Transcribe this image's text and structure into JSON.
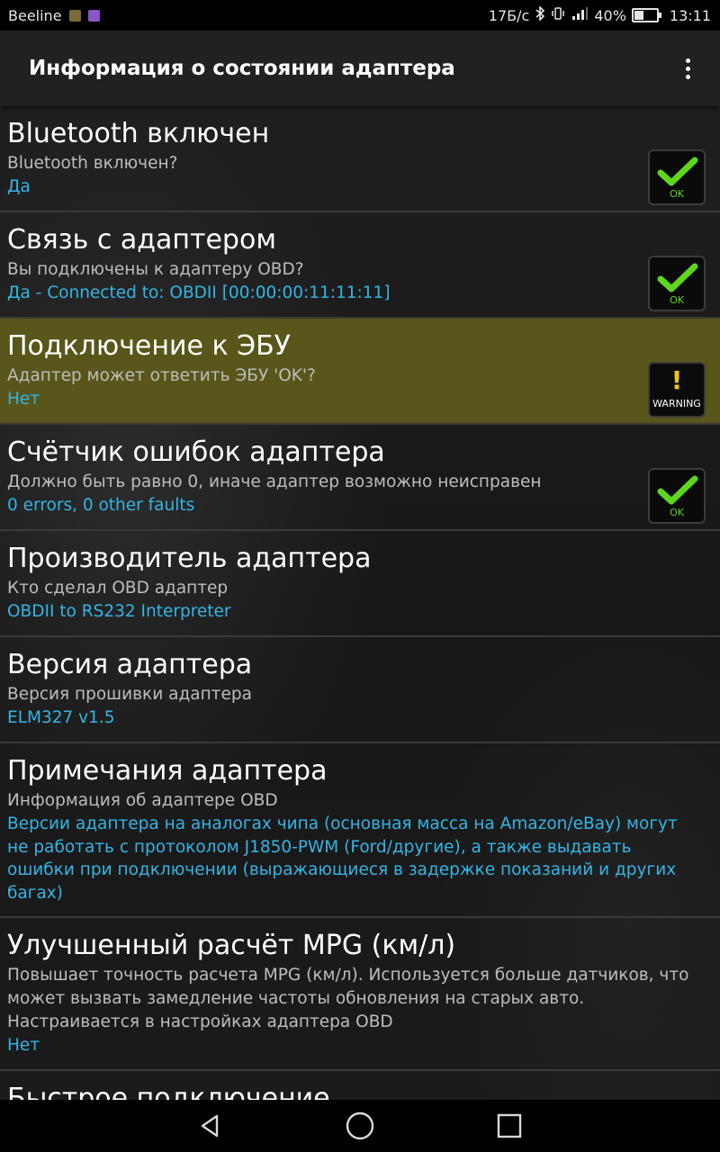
{
  "status_bar": {
    "carrier": "Beeline",
    "speed": "17Б/с",
    "battery": "40%",
    "battery_level": 0.4,
    "time": "13:11",
    "icons": [
      "gallery-icon",
      "viber-icon",
      "bluetooth-icon",
      "vibrate-icon",
      "signal-icon",
      "battery-icon"
    ]
  },
  "app_bar": {
    "title": "Информация о состоянии адаптера",
    "menu_icon": "overflow-menu-icon"
  },
  "colors": {
    "accent": "#33b5e5",
    "highlight": "#58561a",
    "ok_green": "#5ed61d",
    "warning_yellow": "#f0c419"
  },
  "items": [
    {
      "title": "Bluetooth включен",
      "subtitle": "Bluetooth включен?",
      "value": "Да",
      "status": "OK"
    },
    {
      "title": "Связь с адаптером",
      "subtitle": "Вы подключены к адаптеру OBD?",
      "value": "Да - Connected to: OBDII [00:00:00:11:11:11]",
      "status": "OK"
    },
    {
      "title": "Подключение к ЭБУ",
      "subtitle": "Адаптер может ответить ЭБУ 'OK'?",
      "value": "Нет",
      "status": "WARNING"
    },
    {
      "title": "Счётчик ошибок адаптера",
      "subtitle": "Должно быть равно 0, иначе адаптер возможно неисправен",
      "value": "0 errors, 0 other faults",
      "status": "OK"
    },
    {
      "title": "Производитель адаптера",
      "subtitle": "Кто сделал OBD адаптер",
      "value": "OBDII to RS232 Interpreter"
    },
    {
      "title": "Версия адаптера",
      "subtitle": "Версия прошивки адаптера",
      "value": "ELM327 v1.5"
    },
    {
      "title": "Примечания адаптера",
      "subtitle": "Информация об адаптере OBD",
      "value": "Версии адаптера на аналогах чипа (основная масса на Amazon/eBay) могут не работать с протоколом J1850-PWM (Ford/другие), а также выдавать ошибки при подключении (выражающиеся в задержке показаний и других багах)"
    },
    {
      "title": "Улучшенный расчёт MPG (км/л)",
      "subtitle": "Повышает точность расчета MPG (км/л). Используется больше датчиков, что может вызвать замедление частоты обновления на старых авто. Настраивается в настройках адаптера OBD",
      "value": "Нет"
    },
    {
      "title": "Быстрое подключение"
    }
  ],
  "nav_bar": {
    "back": "back-icon",
    "home": "home-icon",
    "recents": "recents-icon"
  }
}
